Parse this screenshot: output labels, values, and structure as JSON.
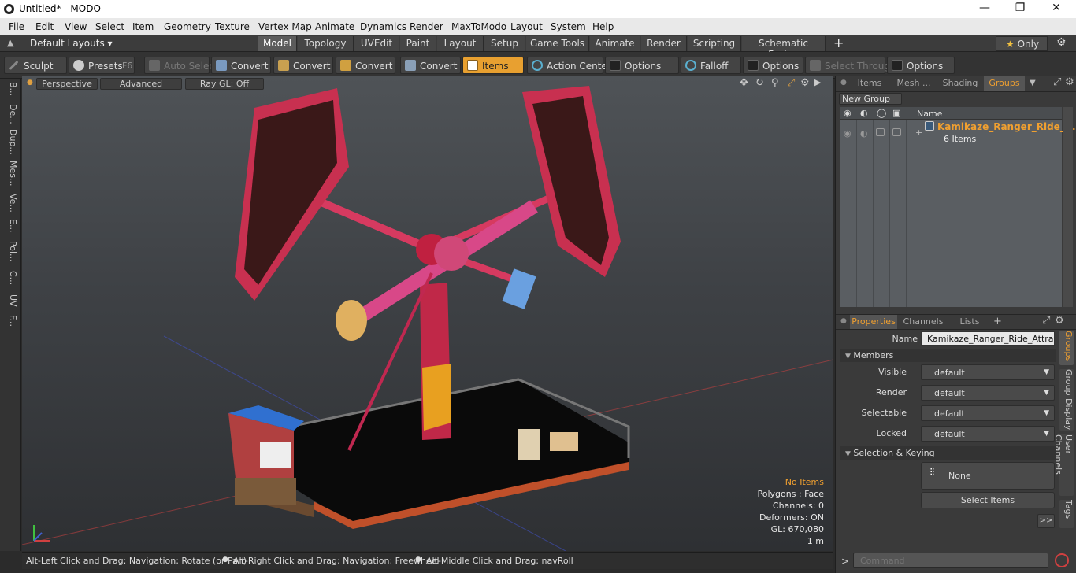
{
  "window": {
    "title": "Untitled* - MODO",
    "min": "—",
    "max": "❐",
    "close": "✕"
  },
  "menu": [
    "File",
    "Edit",
    "View",
    "Select",
    "Item",
    "Geometry",
    "Texture",
    "Vertex Map",
    "Animate",
    "Dynamics",
    "Render",
    "MaxToModo",
    "Layout",
    "System",
    "Help"
  ],
  "layoutbar": {
    "preset": "Default Layouts",
    "tabs": [
      "Model",
      "Topology",
      "UVEdit",
      "Paint",
      "Layout",
      "Setup",
      "Game Tools",
      "Animate",
      "Render",
      "Scripting",
      "Schematic Fusion"
    ],
    "active_tab": "Model",
    "add": "+",
    "only": "Only",
    "star": "★"
  },
  "toolbar": {
    "sculpt": "Sculpt",
    "presets": "Presets",
    "presets_key": "F6",
    "auto_select": "Auto Select",
    "convert1": "Convert",
    "convert2": "Convert",
    "convert3": "Convert",
    "convert4": "Convert",
    "items": "Items",
    "action_center": "Action Center",
    "options1": "Options",
    "falloff": "Falloff",
    "options2": "Options",
    "select_through": "Select Through",
    "options3": "Options"
  },
  "left_tabs": [
    "B...",
    "De...",
    "Dup...",
    "Mes...",
    "Ve...",
    "E...",
    "Pol...",
    "C...",
    "UV",
    "F..."
  ],
  "viewport": {
    "perspective": "Perspective",
    "advanced": "Advanced",
    "raygl": "Ray GL: Off",
    "stats": {
      "no_items": "No Items",
      "polygons": "Polygons : Face",
      "channels": "Channels: 0",
      "deformers": "Deformers: ON",
      "gl": "GL: 670,080",
      "scale": "1 m"
    }
  },
  "statusbar": {
    "hint1": "Alt-Left Click and Drag: Navigation: Rotate (or Pan)",
    "hint2": "Alt-Right Click and Drag: Navigation: Freewheel",
    "hint3": "Alt-Middle Click and Drag: navRoll"
  },
  "groups_panel": {
    "tabs": [
      "Items",
      "Mesh ...",
      "Shading",
      "Groups"
    ],
    "active_tab": "Groups",
    "new_group": "New Group",
    "col_name": "Name",
    "group_name": "Kamikaze_Ranger_Ride_...",
    "group_count": "6 Items"
  },
  "properties_panel": {
    "tabs": [
      "Properties",
      "Channels",
      "Lists"
    ],
    "active_tab": "Properties",
    "add": "+",
    "name_label": "Name",
    "name_value": "Kamikaze_Ranger_Ride_Attractio",
    "members_header": "Members",
    "rows": [
      {
        "label": "Visible",
        "value": "default"
      },
      {
        "label": "Render",
        "value": "default"
      },
      {
        "label": "Selectable",
        "value": "default"
      },
      {
        "label": "Locked",
        "value": "default"
      }
    ],
    "selection_header": "Selection & Keying",
    "none_btn": "None",
    "select_items_btn": "Select Items",
    "more": ">>",
    "side_tabs": [
      "Groups",
      "Group Display",
      "User Channels",
      "Tags"
    ]
  },
  "command": {
    "placeholder": "Command",
    "prompt": ">"
  },
  "colors": {
    "accent": "#f0a030",
    "ride_red": "#d62a4a",
    "viewport_bg": "#45484c"
  }
}
